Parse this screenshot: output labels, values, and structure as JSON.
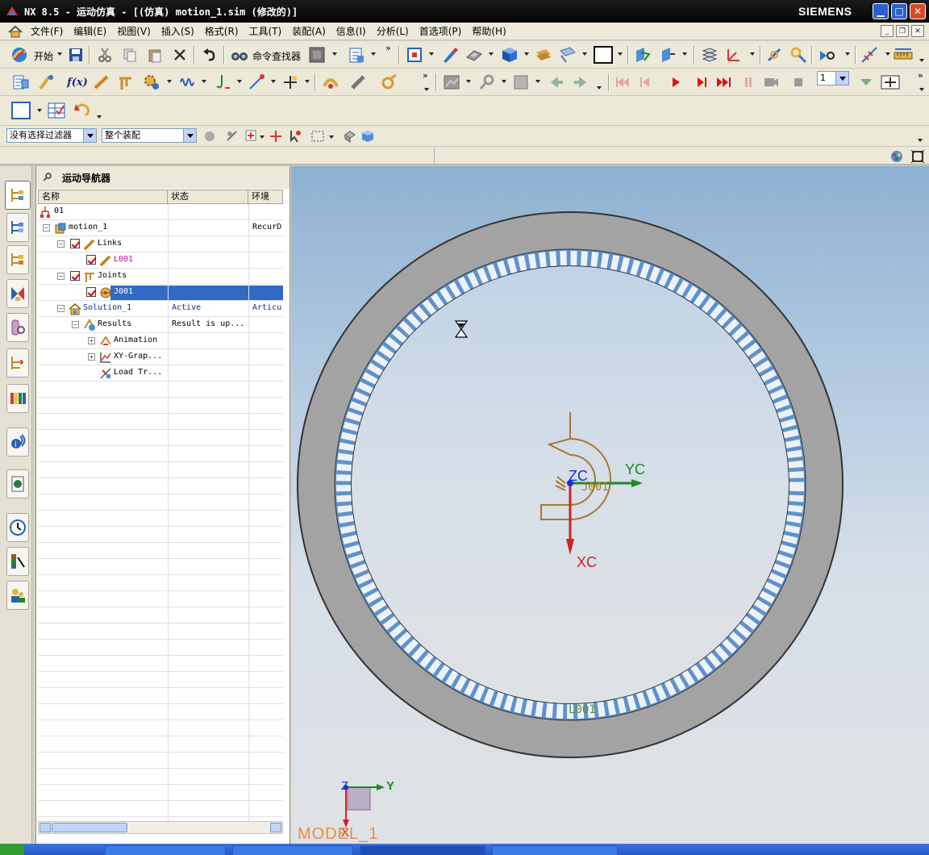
{
  "window": {
    "title": "NX 8.5 - 运动仿真 - [(仿真) motion_1.sim (修改的)]",
    "brand": "SIEMENS",
    "minimize": "▁",
    "maximize": "□",
    "close": "✕"
  },
  "menu": {
    "items": [
      "文件(F)",
      "编辑(E)",
      "视图(V)",
      "插入(S)",
      "格式(R)",
      "工具(T)",
      "装配(A)",
      "信息(I)",
      "分析(L)",
      "首选项(P)",
      "帮助(H)"
    ]
  },
  "toolbar": {
    "start_label": "开始",
    "command_finder_label": "命令查找器",
    "frame_value": "1"
  },
  "filterbar": {
    "selection_filter": "没有选择过滤器",
    "assembly_scope": "整个装配"
  },
  "navigator": {
    "title": "运动导航器",
    "columns": [
      "名称",
      "状态",
      "环境"
    ],
    "rows": [
      {
        "name": "01",
        "status": "",
        "env": ""
      },
      {
        "name": "motion_1",
        "status": "",
        "env": "RecurD"
      },
      {
        "name": "Links",
        "status": "",
        "env": ""
      },
      {
        "name": "L001",
        "status": "",
        "env": ""
      },
      {
        "name": "Joints",
        "status": "",
        "env": ""
      },
      {
        "name": "J001",
        "status": "",
        "env": ""
      },
      {
        "name": "Solution_1",
        "status": "Active",
        "env": "Articu"
      },
      {
        "name": "Results",
        "status": "Result is up...",
        "env": ""
      },
      {
        "name": "Animation",
        "status": "",
        "env": ""
      },
      {
        "name": "XY-Grap...",
        "status": "",
        "env": ""
      },
      {
        "name": "Load Tr...",
        "status": "",
        "env": ""
      }
    ]
  },
  "viewport": {
    "labels": {
      "zc": "ZC",
      "yc": "YC",
      "xc": "XC",
      "joint": "J001",
      "link": "L001",
      "triad_z": "Z",
      "triad_y": "Y",
      "triad_x": "X",
      "model": "MODEL_1"
    },
    "colors": {
      "ring_gray": "#a3a3a3",
      "ring_blue": "#5f92cd",
      "axis_red": "#d0202a",
      "axis_green": "#1f8a23",
      "axis_blue": "#1a2fd6",
      "joint_brown": "#a8782a",
      "model_orange": "#f08a3a"
    }
  }
}
